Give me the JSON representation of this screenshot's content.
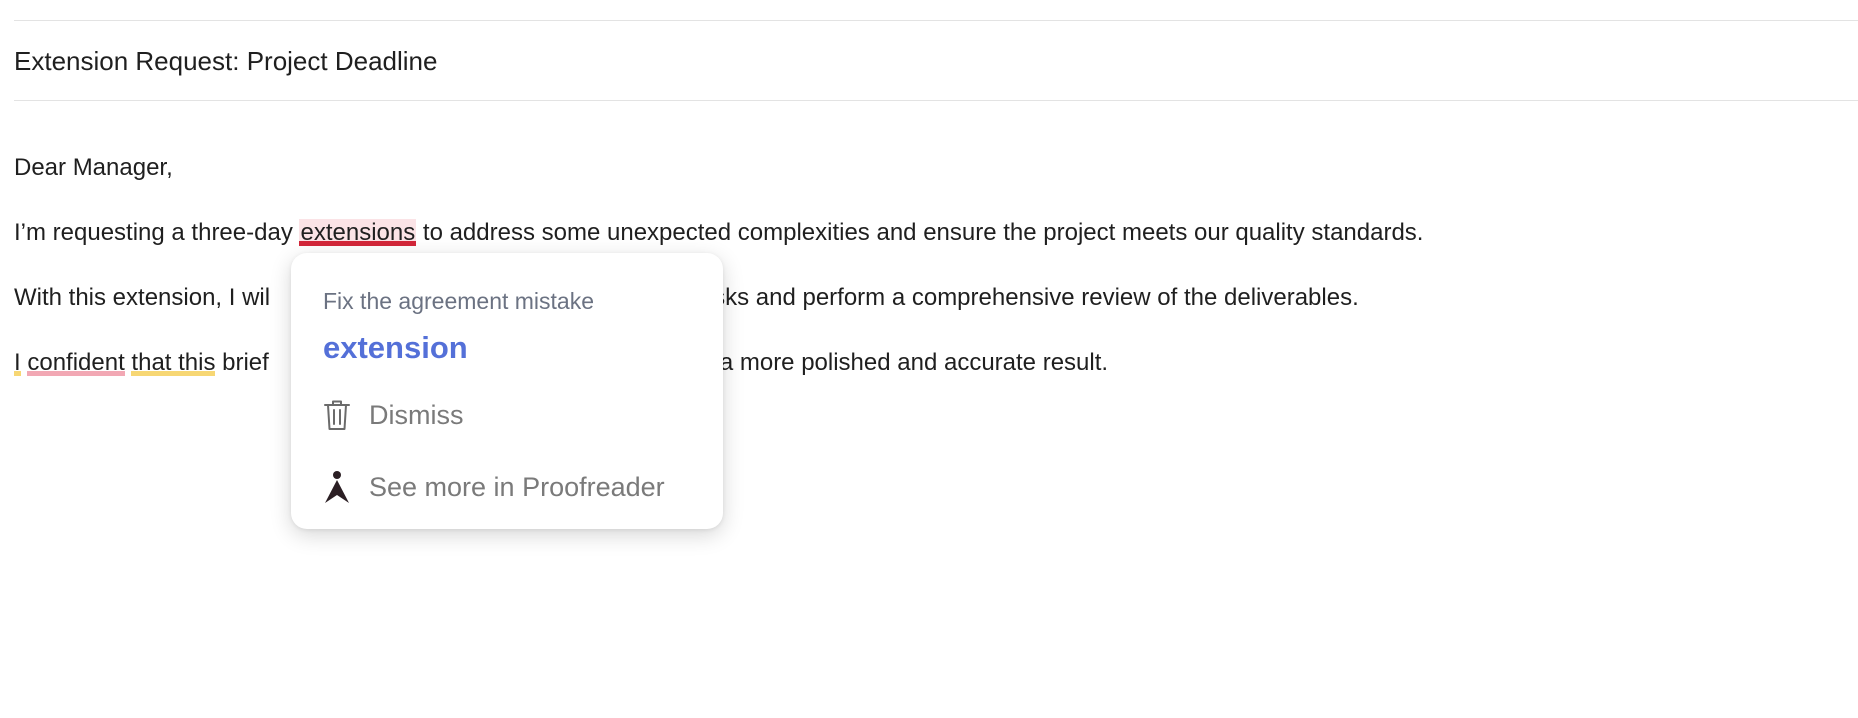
{
  "email": {
    "subject": "Extension Request: Project Deadline",
    "greeting": "Dear Manager,",
    "paragraph1": {
      "before": "I’m requesting a three-day ",
      "flagged": "extensions",
      "after": " to address some unexpected complexities and ensure the project meets our quality standards."
    },
    "paragraph2": {
      "visible_start": "With this extension, I wil",
      "visible_end": "sks and perform a comprehensive review of the deliverables."
    },
    "paragraph3": {
      "word_i": "I",
      "word_confident": "confident",
      "phrase_that_this": "that this",
      "visible_brief": " brief",
      "visible_end": "or a more polished and accurate result."
    }
  },
  "suggestion_popup": {
    "heading": "Fix the agreement mistake",
    "replacement": "extension",
    "actions": [
      {
        "label": "Dismiss",
        "icon": "trash-icon"
      },
      {
        "label": "See more in Proofreader",
        "icon": "proofreader-icon"
      }
    ]
  },
  "colors": {
    "error_underline": "#d3273a",
    "error_highlight": "#fbe3e6",
    "suggestion_text": "#5470d8",
    "style_underline_yellow": "#f7d774",
    "style_underline_pink": "#f2a8b4"
  }
}
